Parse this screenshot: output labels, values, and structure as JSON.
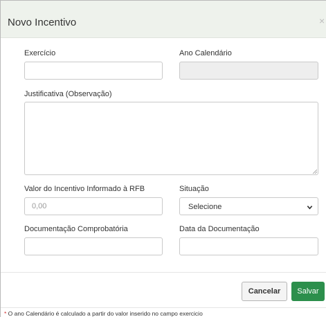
{
  "modal": {
    "title": "Novo Incentivo",
    "close_label": "×"
  },
  "form": {
    "exercicio_label": "Exercício",
    "exercicio_value": "",
    "ano_calendario_label": "Ano Calendário",
    "ano_calendario_value": "",
    "justificativa_label": "Justificativa (Observação)",
    "justificativa_value": "",
    "valor_label": "Valor do Incentivo Informado à RFB",
    "valor_placeholder": "0,00",
    "situacao_label": "Situação",
    "situacao_selected": "Selecione",
    "documentacao_label": "Documentação Comprobatória",
    "documentacao_value": "",
    "data_documentacao_label": "Data da Documentação",
    "data_documentacao_value": ""
  },
  "footer": {
    "cancel_label": "Cancelar",
    "save_label": "Salvar"
  },
  "footnote": {
    "star": "*",
    "text": " O ano Calendário é calculado a partir do valor inserido no campo exercicio"
  }
}
